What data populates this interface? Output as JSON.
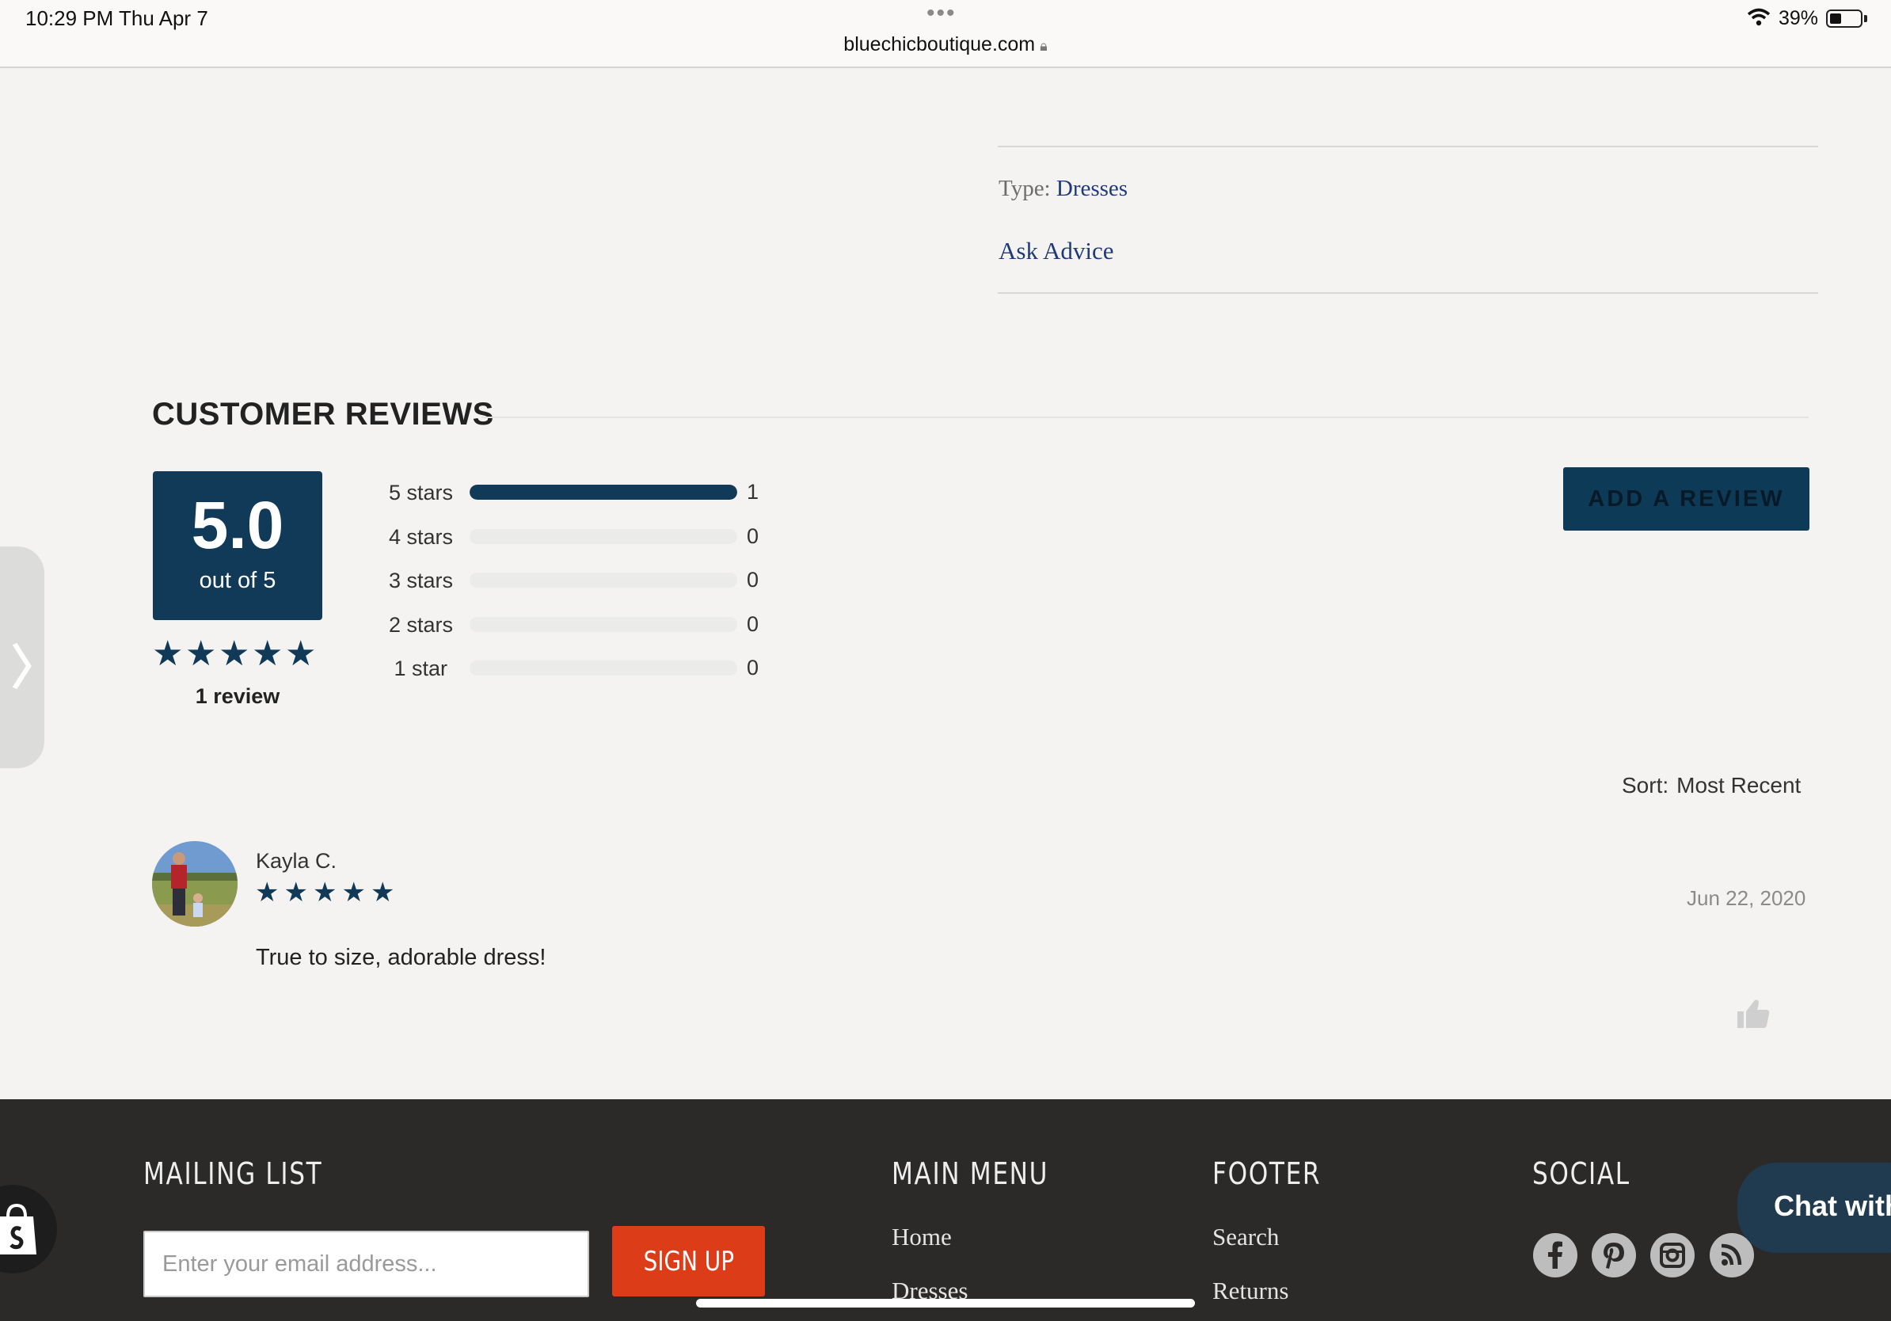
{
  "status_bar": {
    "time": "10:29 PM   Thu Apr 7",
    "dots": "•••",
    "url": "bluechicboutique.com",
    "battery": "39%",
    "battery_level": 0.39
  },
  "product_meta": {
    "type_label": "Type:",
    "type_value": "Dresses",
    "ask_advice": "Ask Advice"
  },
  "reviews": {
    "title": "CUSTOMER REVIEWS",
    "average": "5.0",
    "average_sub": "out of 5",
    "summary_rating": 5,
    "count_label": "1 review",
    "add_review": "ADD A REVIEW",
    "histogram": [
      {
        "label": "5 stars",
        "count": "1",
        "fraction": 1.0
      },
      {
        "label": "4 stars",
        "count": "0",
        "fraction": 0
      },
      {
        "label": "3 stars",
        "count": "0",
        "fraction": 0
      },
      {
        "label": "2 stars",
        "count": "0",
        "fraction": 0
      },
      {
        "label": "1 star",
        "count": "0",
        "fraction": 0
      }
    ],
    "sort_label": "Sort:",
    "sort_value": "Most Recent",
    "items": [
      {
        "name": "Kayla C.",
        "rating": 5,
        "date": "Jun 22, 2020",
        "body": "True to size, adorable dress!"
      }
    ]
  },
  "footer": {
    "mailing_list": "MAILING LIST",
    "email_placeholder": "Enter your email address...",
    "signup": "SIGN UP",
    "main_menu": "MAIN MENU",
    "menu_links": [
      "Home",
      "Dresses"
    ],
    "footer_head": "FOOTER",
    "footer_links": [
      "Search",
      "Returns"
    ],
    "social_head": "SOCIAL",
    "social_icons": [
      "facebook-icon",
      "pinterest-icon",
      "instagram-icon",
      "rss-icon"
    ],
    "chat": "Chat with"
  },
  "colors": {
    "brand_navy": "#103a57",
    "link_blue": "#1e3a7b",
    "signup_red": "#dc3d18",
    "footer_bg": "#2b2a29"
  }
}
